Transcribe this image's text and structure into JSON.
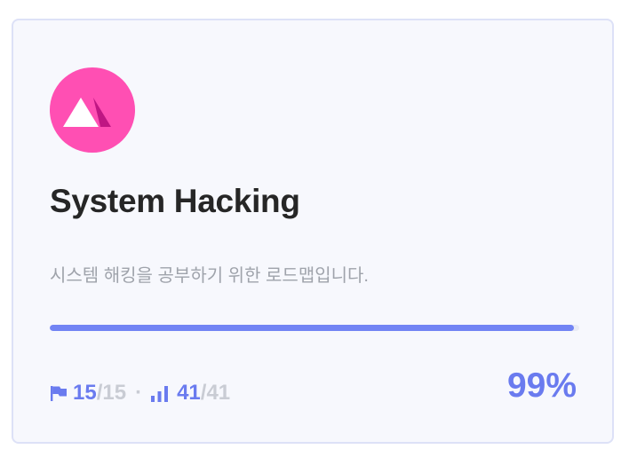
{
  "card": {
    "title": "System Hacking",
    "description": "시스템 해킹을 공부하기 위한 로드맵입니다.",
    "progress_fraction": 0.99,
    "percent_label": "99%",
    "logo_icon": "mountain-icon",
    "stats": {
      "flags": {
        "icon": "flag-icon",
        "current": "15",
        "total": "/15"
      },
      "separator": "·",
      "levels": {
        "icon": "bar-chart-icon",
        "current": "41",
        "total": "/41"
      }
    }
  },
  "colors": {
    "accent": "#7284f4",
    "logo_bg": "#ff4fb3",
    "logo_dark": "#c21a86",
    "card_bg": "#f7f8fd",
    "border": "#dde1f7"
  }
}
